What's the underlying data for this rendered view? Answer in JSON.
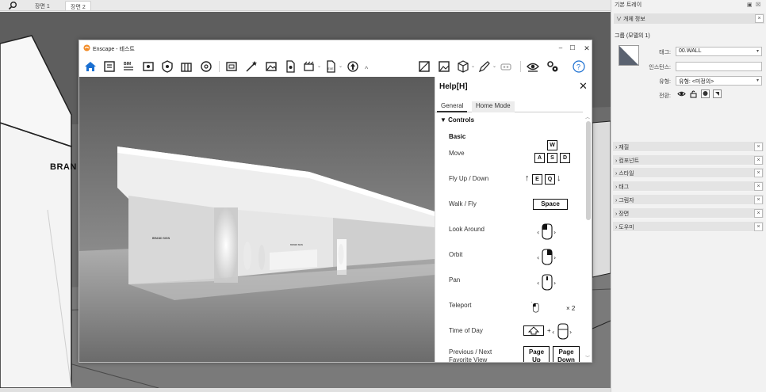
{
  "sketchup": {
    "scene_tabs": [
      "장면 1",
      "장면 2"
    ],
    "brand_text": "BRAN",
    "viewport_label": "면\n0"
  },
  "enscape": {
    "title": "Enscape - 테스트",
    "window_buttons": {
      "minimize": "–",
      "maximize": "☐",
      "close": "✕"
    },
    "render": {
      "brand_sign_left": "BRAND SIGN",
      "brand_sign_right": "BRAND SIGN"
    },
    "help": {
      "title": "Help[H]",
      "close": "✕",
      "tabs": [
        "General",
        "Home Mode"
      ],
      "section": "Controls",
      "subsection": "Basic",
      "controls": [
        {
          "label": "Move",
          "keys": [
            "W",
            "A",
            "S",
            "D"
          ]
        },
        {
          "label": "Fly Up / Down",
          "keys": [
            "E",
            "Q"
          ]
        },
        {
          "label": "Walk / Fly",
          "keys": [
            "Space"
          ]
        },
        {
          "label": "Look Around",
          "keys": []
        },
        {
          "label": "Orbit",
          "keys": []
        },
        {
          "label": "Pan",
          "keys": []
        },
        {
          "label": "Teleport",
          "keys": [
            "× 2"
          ]
        },
        {
          "label": "Time of Day",
          "keys": [
            "+"
          ]
        },
        {
          "label": "Previous / Next Favorite View",
          "keys": [
            "Page Up",
            "Page Down"
          ]
        }
      ]
    }
  },
  "tray": {
    "title": "기본 트레이",
    "entity_info": {
      "header": "개체 정보",
      "group_name": "그룹 (모델의 1)",
      "tag_label": "태그:",
      "tag_value": "00.WALL",
      "instance_label": "인스턴스:",
      "instance_value": "",
      "type_label": "유형:",
      "type_value": "유형: <미정의>",
      "toggle_label": "전환:"
    },
    "sections": [
      "재질",
      "컴포넌트",
      "스타일",
      "태그",
      "그림자",
      "장면",
      "도우미"
    ]
  },
  "colors": {
    "accent_blue": "#1a6fd1",
    "enscape_orange": "#f28c28",
    "viewport_gray": "#6f6f6f"
  }
}
